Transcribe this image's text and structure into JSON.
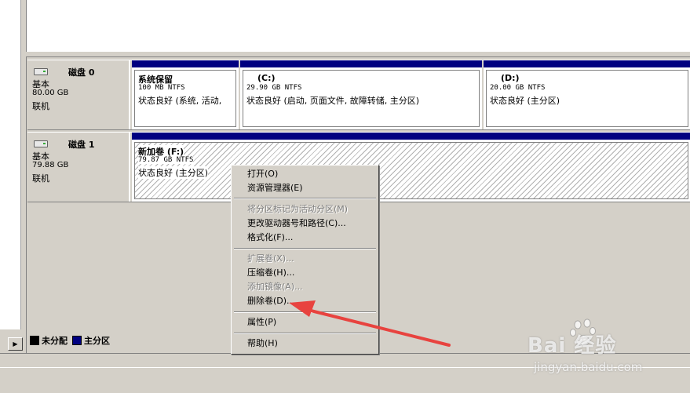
{
  "disks": [
    {
      "name": "磁盘 0",
      "type": "基本",
      "size": "80.00 GB",
      "state": "联机",
      "volumes": [
        {
          "name": "系统保留",
          "size": "100 MB NTFS",
          "status": "状态良好 (系统, 活动,"
        },
        {
          "name": "(C:)",
          "size": "29.90 GB NTFS",
          "status": "状态良好 (启动, 页面文件, 故障转储, 主分区)"
        },
        {
          "name": "(D:)",
          "size": "20.00 GB NTFS",
          "status": "状态良好 (主分区)"
        }
      ]
    },
    {
      "name": "磁盘 1",
      "type": "基本",
      "size": "79.88 GB",
      "state": "联机",
      "volumes": [
        {
          "name": "新加卷  (F:)",
          "size": "79.87 GB NTFS",
          "status": "状态良好 (主分区)"
        }
      ]
    }
  ],
  "legend": {
    "unallocated": "未分配",
    "primary": "主分区"
  },
  "context_menu": {
    "open": "打开(O)",
    "explorer": "资源管理器(E)",
    "mark_active": "将分区标记为活动分区(M)",
    "change_letter": "更改驱动器号和路径(C)...",
    "format": "格式化(F)...",
    "extend": "扩展卷(X)...",
    "shrink": "压缩卷(H)...",
    "add_mirror": "添加镜像(A)...",
    "delete": "删除卷(D)...",
    "properties": "属性(P)",
    "help": "帮助(H)"
  },
  "watermark": {
    "logo": "Bai 经验",
    "url": "jingyan.baidu.com"
  },
  "colors": {
    "primary_partition": "#000080",
    "unallocated": "#000000",
    "annotation_arrow": "#e8433f"
  }
}
